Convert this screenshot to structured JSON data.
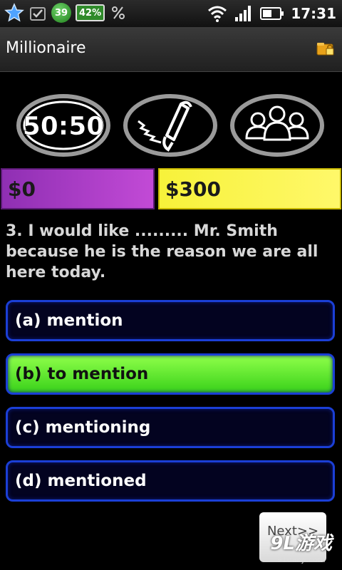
{
  "status_bar": {
    "time": "17:31",
    "badge_round": "39",
    "badge_battery": "42%",
    "icons": [
      "star-icon",
      "download-check-icon",
      "usb-percent-icon",
      "wifi-icon",
      "signal-icon",
      "battery-icon"
    ]
  },
  "titlebar": {
    "title": "Millionaire",
    "icon": "lock-folder-icon"
  },
  "lifelines": {
    "fifty_fifty_label": "50:50",
    "phone_icon": "phone-a-friend-icon",
    "audience_icon": "ask-audience-icon"
  },
  "money": {
    "current": "$0",
    "target": "$300"
  },
  "question": {
    "text": "3. I would like ......... Mr. Smith because he is the reason we are all here today."
  },
  "answers": [
    {
      "label": "(a) mention",
      "selected": false
    },
    {
      "label": "(b) to mention",
      "selected": true
    },
    {
      "label": "(c) mentioning",
      "selected": false
    },
    {
      "label": "(d) mentioned",
      "selected": false
    }
  ],
  "next_button": {
    "label": "Next>>"
  },
  "watermark": {
    "logo": "9L游戏",
    "url": "91danji.com"
  },
  "colors": {
    "answer_border": "#1b3fd6",
    "answer_selected": "#5be62a",
    "money_current_bg": "#b13fcc",
    "money_target_bg": "#fff34a"
  }
}
